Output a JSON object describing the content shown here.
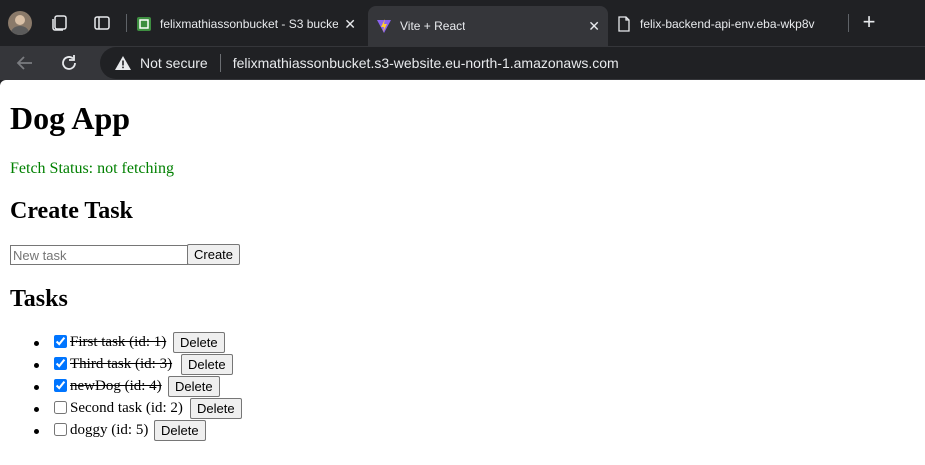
{
  "tabs": [
    {
      "title": "felixmathiassonbucket - S3 bucke",
      "favicon": "s3-bucket-icon"
    },
    {
      "title": "Vite + React",
      "favicon": "vite-icon"
    },
    {
      "title": "felix-backend-api-env.eba-wkp8v",
      "favicon": "page-icon"
    }
  ],
  "omnibox": {
    "security": "Not secure",
    "url": "felixmathiassonbucket.s3-website.eu-north-1.amazonaws.com"
  },
  "page": {
    "title": "Dog App",
    "fetch_status": "Fetch Status: not fetching",
    "create_heading": "Create Task",
    "new_task_placeholder": "New task",
    "create_button": "Create",
    "tasks_heading": "Tasks",
    "delete_label": "Delete",
    "tasks": [
      {
        "label": "First task (id: 1)",
        "done": true
      },
      {
        "label": "Third task (id: 3)",
        "done": true
      },
      {
        "label": "newDog (id: 4)",
        "done": true
      },
      {
        "label": "Second task (id: 2)",
        "done": false
      },
      {
        "label": "doggy (id: 5)",
        "done": false
      }
    ]
  },
  "colors": {
    "status": "#008000",
    "chrome_dark": "#202124",
    "chrome_toolbar": "#35363a"
  }
}
